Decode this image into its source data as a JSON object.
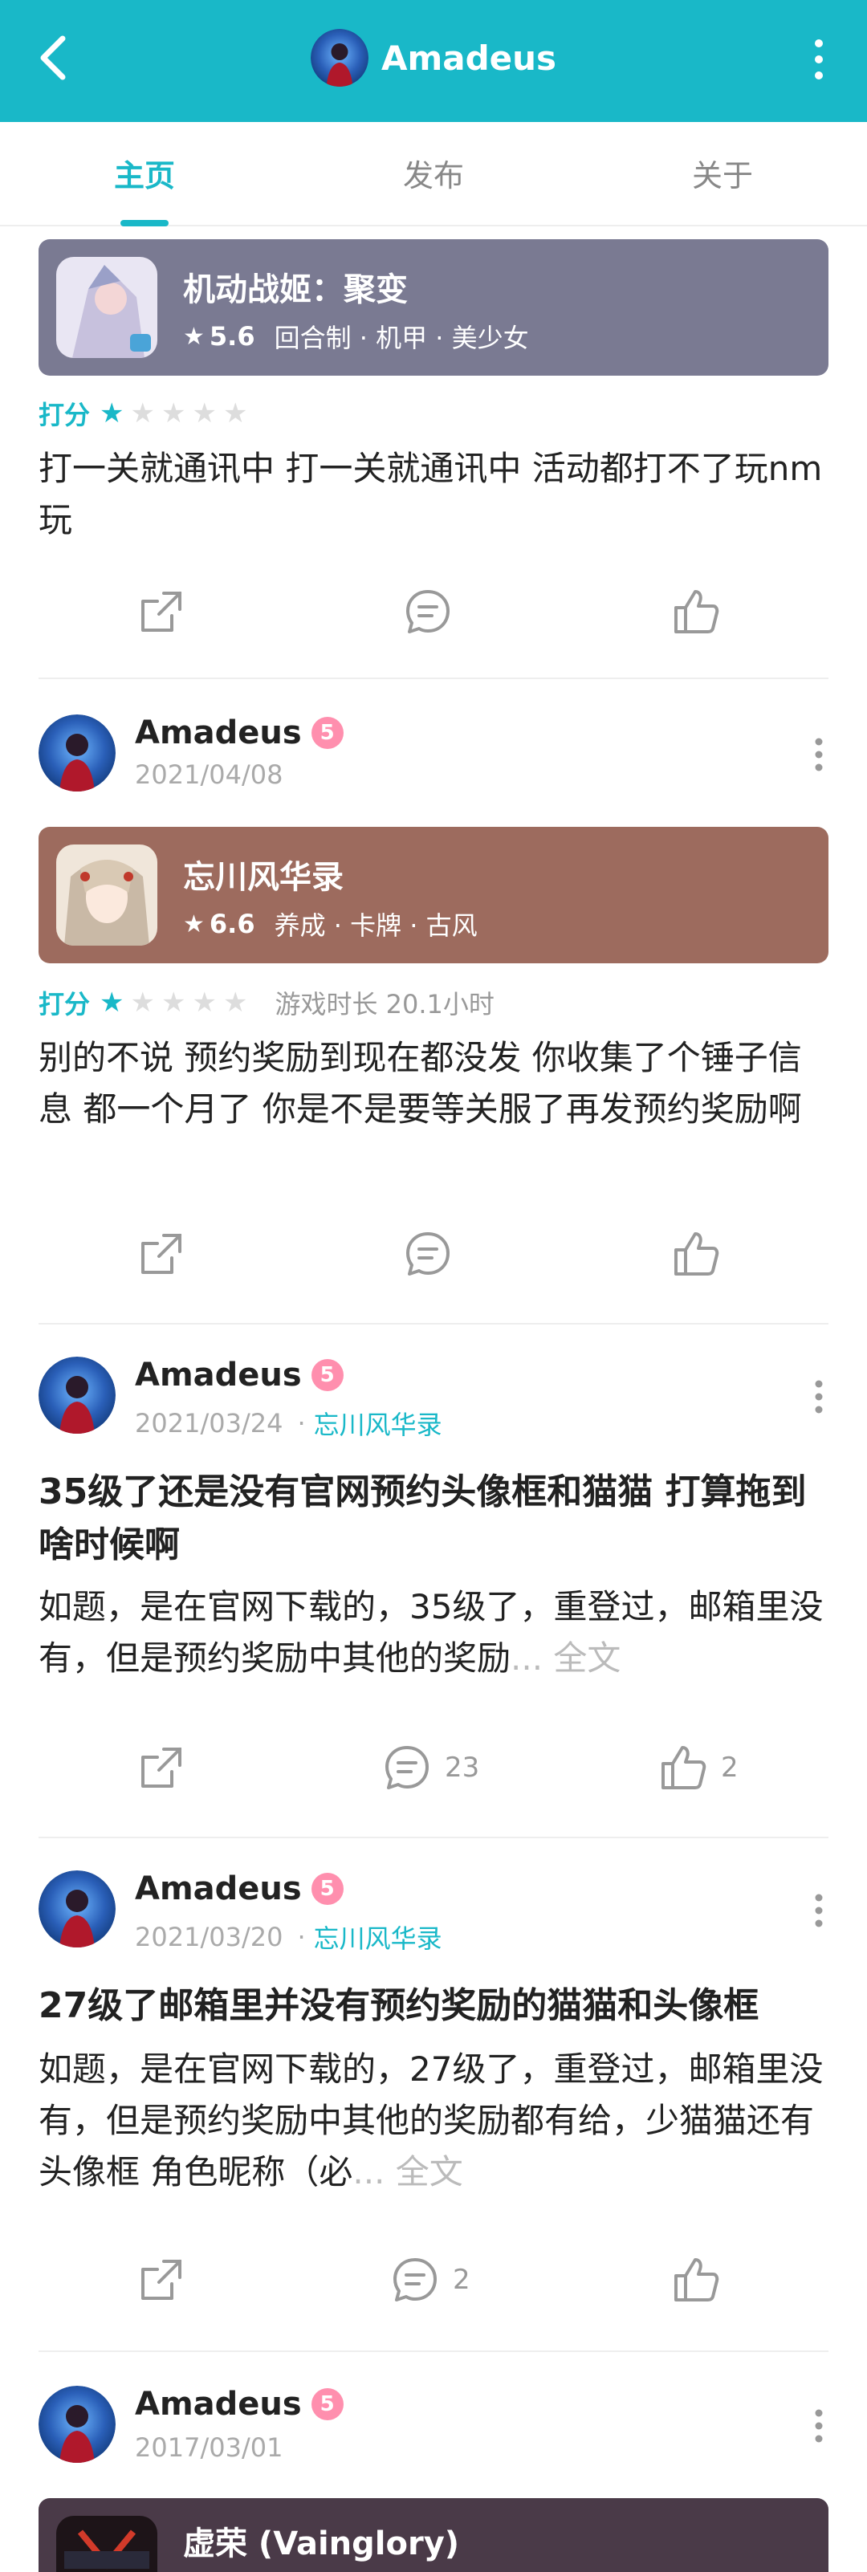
{
  "header": {
    "title": "Amadeus",
    "bg_color": "#19b8c8"
  },
  "tabs": [
    {
      "label": "主页",
      "active": true
    },
    {
      "label": "发布",
      "active": false
    },
    {
      "label": "关于",
      "active": false
    }
  ],
  "feed": {
    "item1": {
      "game": {
        "name": "机动战姬：聚变",
        "score": "5.6",
        "tags": "回合制 · 机甲 · 美少女",
        "card_color": "#7a7a92"
      },
      "rating_label": "打分",
      "rating": 1,
      "text": "打一关就通讯中 打一关就通讯中 活动都打不了玩nm玩"
    },
    "item2": {
      "author": "Amadeus",
      "badge": "5",
      "date": "2021/04/08",
      "game": {
        "name": "忘川风华录",
        "score": "6.6",
        "tags": "养成 · 卡牌 · 古风",
        "card_color": "#9d6b5e"
      },
      "rating_label": "打分",
      "rating": 1,
      "play_time": "游戏时长 20.1小时",
      "text": "别的不说 预约奖励到现在都没发 你收集了个锤子信息 都一个月了 你是不是要等关服了再发预约奖励啊"
    },
    "item3": {
      "author": "Amadeus",
      "badge": "5",
      "date": "2021/03/24",
      "game_link": "忘川风华录",
      "title": "35级了还是没有官网预约头像框和猫猫 打算拖到啥时候啊",
      "text": "如题，是在官网下载的，35级了，重登过，邮箱里没有，但是预约奖励中其他的奖励",
      "more": "... 全文",
      "comments": "23",
      "likes": "2"
    },
    "item4": {
      "author": "Amadeus",
      "badge": "5",
      "date": "2021/03/20",
      "game_link": "忘川风华录",
      "title": "27级了邮箱里并没有预约奖励的猫猫和头像框",
      "text": "如题，是在官网下载的，27级了，重登过，邮箱里没有，但是预约奖励中其他的奖励都有给，少猫猫还有头像框  角色昵称（必",
      "more": "... 全文",
      "comments": "2",
      "likes": ""
    },
    "item5": {
      "author": "Amadeus",
      "badge": "5",
      "date": "2017/03/01",
      "game": {
        "name": "虚荣 (Vainglory)",
        "card_color": "#4a3a48"
      }
    }
  },
  "icons": {
    "back": "chevron-left-icon",
    "more": "more-vertical-icon",
    "share": "share-icon",
    "comment": "comment-icon",
    "like": "thumbs-up-icon",
    "star": "star-icon"
  }
}
